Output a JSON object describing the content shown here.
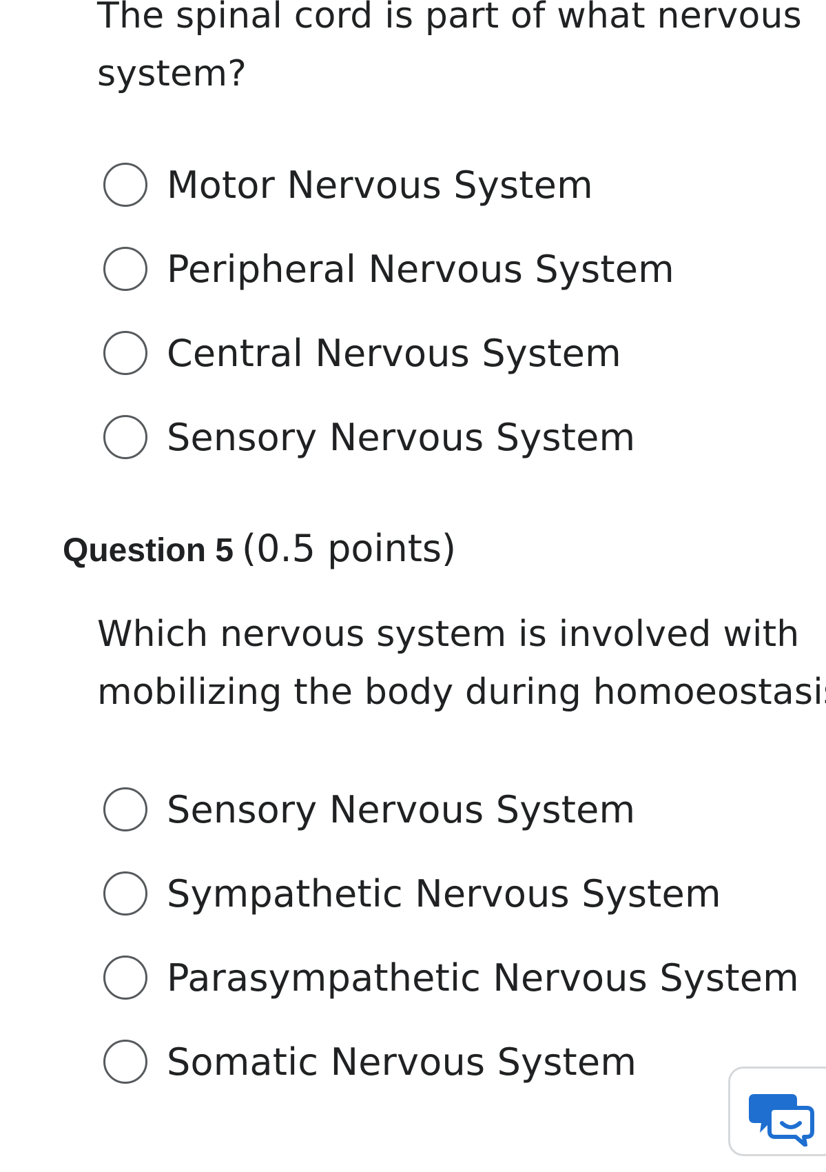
{
  "question4": {
    "prompt_line1": "The spinal cord is part of what nervous",
    "prompt_line2": "system?",
    "options": [
      {
        "label": "Motor Nervous System"
      },
      {
        "label": "Peripheral Nervous System"
      },
      {
        "label": "Central Nervous System"
      },
      {
        "label": "Sensory Nervous System"
      }
    ]
  },
  "question5": {
    "title": "Question 5",
    "points": "(0.5 points)",
    "prompt_line1": "Which nervous system is involved with",
    "prompt_line2": "mobilizing the body during homoeostasis?",
    "options": [
      {
        "label": "Sensory Nervous System"
      },
      {
        "label": "Sympathetic Nervous System"
      },
      {
        "label": "Parasympathetic Nervous System"
      },
      {
        "label": "Somatic Nervous System"
      }
    ]
  },
  "colors": {
    "text": "#202122",
    "radio_border": "#565a5c",
    "chat_icon": "#1f6fd1",
    "widget_border": "#d6d8da"
  },
  "icons": {
    "chat_widget": "chat-bubble-icon"
  }
}
